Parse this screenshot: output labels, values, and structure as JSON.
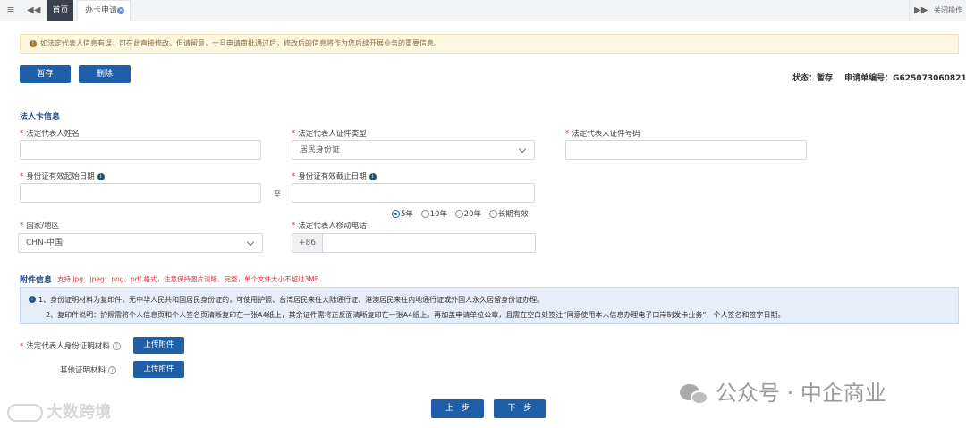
{
  "tabbar": {
    "home_tab": "首页",
    "apply_tab": "办卡申请",
    "close_ops": "关闭操作"
  },
  "warning": {
    "text": "如法定代表人信息有误，可在此直接修改。但请留意，一旦申请审批通过后，修改后的信息将作为您后续开展业务的重要信息。"
  },
  "toolbar": {
    "save_label": "暂存",
    "delete_label": "删除"
  },
  "status": {
    "state": "状态：暂存",
    "order_no": "申请单编号：G625073060821"
  },
  "legal": {
    "section_title": "法人卡信息",
    "name_label": "法定代表人姓名",
    "name_value": "",
    "id_type_label": "法定代表人证件类型",
    "id_type_value": "居民身份证",
    "id_no_label": "法定代表人证件号码",
    "id_no_value": "",
    "start_date_label": "身份证有效起始日期",
    "start_date_value": "",
    "to": "至",
    "end_date_label": "身份证有效截止日期",
    "end_date_value": "",
    "validity_options": [
      {
        "label": "5年",
        "checked": true
      },
      {
        "label": "10年",
        "checked": false
      },
      {
        "label": "20年",
        "checked": false
      },
      {
        "label": "长期有效",
        "checked": false
      }
    ],
    "country_label": "国家/地区",
    "country_value": "CHN-中国",
    "phone_label": "法定代表人移动电话",
    "phone_prefix": "+86",
    "phone_value": ""
  },
  "attach": {
    "section_title": "附件信息",
    "note": "支持 jpg、jpeg、png、pdf 格式，注意保持图片清晰、完整，单个文件大小不超过3MB",
    "info_line1": "1、身份证明材料为复印件，无中华人民共和国居民身份证的，可使用护照、台湾居民来往大陆通行证、港澳居民来往内地通行证或外国人永久居留身份证办理。",
    "info_line2": "2、复印件说明：护照需将个人信息页和个人签名页清晰复印在一张A4纸上，其余证件需将正反面清晰复印在一张A4纸上。再加盖申请单位公章，且需在空白处签注“同意使用本人信息办理电子口岸制发卡业务”，个人签名和签字日期。",
    "legal_id_label": "法定代表人身份证明材料",
    "other_label": "其他证明材料",
    "upload_label": "上传附件"
  },
  "footer": {
    "prev_label": "上一步",
    "next_label": "下一步"
  },
  "watermark": {
    "left": "大数跨境",
    "right": "公众号 · 中企商业"
  },
  "colors": {
    "primary": "#1f5fa8",
    "required": "#d9363e",
    "warning_bg": "#fdf6e0",
    "info_bg": "#e6eefa"
  }
}
